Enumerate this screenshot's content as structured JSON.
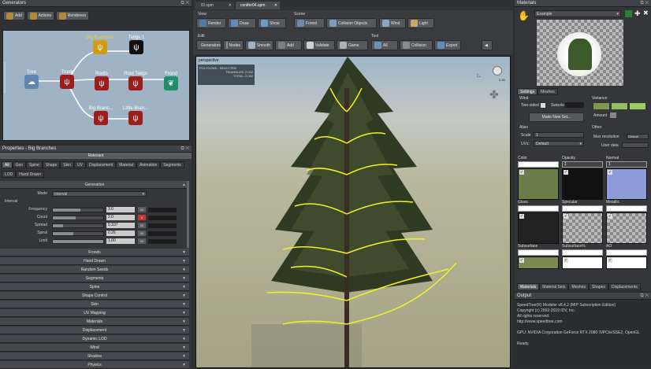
{
  "generator": {
    "title": "Generators",
    "add": "Add",
    "actions": "Actions",
    "renderers": "Renderers",
    "nodes": [
      {
        "id": "tree",
        "label": "Tree"
      },
      {
        "id": "trunk",
        "label": "Trunk"
      },
      {
        "id": "bigbranches",
        "label": "Big Branches"
      },
      {
        "id": "twigs1",
        "label": "Twigs 1"
      },
      {
        "id": "roots",
        "label": "Roots"
      },
      {
        "id": "roottwigs",
        "label": "Root Twigs"
      },
      {
        "id": "frond",
        "label": "Frond"
      },
      {
        "id": "bigbranches2",
        "label": "Big Branc..."
      },
      {
        "id": "littlebranches",
        "label": "Little Bran..."
      }
    ]
  },
  "tabs": {
    "t1": "ID.spm",
    "t2": "conifer04.spm"
  },
  "toolbar": {
    "view_label": "View",
    "scene_label": "Scene",
    "edit_label": "Edit",
    "tool_label": "Tool",
    "buttons": [
      "Render",
      "Draw",
      "Show",
      "Forest",
      "Collision Objects",
      "Wind",
      "Light",
      "Generators",
      "Nodes",
      "Smooth",
      "Add",
      "Validate",
      "Game",
      "All",
      "Collision",
      "Export"
    ]
  },
  "viewport": {
    "label": "perspective",
    "stats_title": "POLYGONS - SELECTED",
    "triangles_label": "TRIANGLES",
    "triangles": "2,032",
    "total_label": "TOTAL",
    "total": "2,032",
    "light_value": "0.45"
  },
  "properties": {
    "title": "Properties - Big Branches",
    "banner": "Relevant",
    "tabs": [
      "All",
      "Gen",
      "Spine",
      "Shape",
      "Skin",
      "UV",
      "Displacement",
      "Material",
      "Animation",
      "Segments",
      "LOD",
      "Hand Drawn"
    ],
    "generation": "Generation",
    "mode_label": "Mode",
    "mode_value": "Interval",
    "interval_label": "Interval",
    "rows": [
      {
        "label": "Frequency",
        "value": "3.0",
        "fill": 0.55,
        "pct": "50"
      },
      {
        "label": "Count",
        "value": "2.0",
        "fill": 0.45,
        "pct": "8"
      },
      {
        "label": "Spread",
        "value": "0.337",
        "fill": 0.2,
        "pct": "50"
      },
      {
        "label": "Spiral",
        "value": "0.26",
        "fill": 0.4,
        "pct": "50"
      },
      {
        "label": "Limit",
        "value": "1.00",
        "fill": 1.0,
        "pct": "50"
      }
    ],
    "sections": [
      "Fronds",
      "Hand Drawn",
      "Random Seeds",
      "Segments",
      "Spine",
      "Shape Control",
      "Skin",
      "UV Mapping",
      "Materials",
      "Displacement",
      "Dynamic LOD",
      "Wind",
      "Shadow",
      "Physics"
    ]
  },
  "materials": {
    "title": "Materials",
    "name_value": "Example",
    "tabs": [
      "Settings",
      "Meshes"
    ],
    "wind_label": "Wind",
    "twosided_label": "Two-sided",
    "swizzle_label": "Swizzle",
    "new_button": "Make New Set...",
    "alias_label": "Alias",
    "scale_label": "Scale",
    "scale_value": "1",
    "uv_label": "UVs:",
    "uv_value": "Default",
    "variance_label": "Variance",
    "amount_label": "Amount",
    "other_label": "Other",
    "maxres_label": "Max resolution",
    "maxres_value": "Default",
    "userdata_label": "User data",
    "slots": [
      "Color",
      "Opacity",
      "Normal",
      "Gloss",
      "Specular",
      "Metallic",
      "Subsurface",
      "Subsurface%",
      "AO"
    ],
    "opacity_value": "1",
    "normal_value": "1",
    "bottom_tabs": [
      "Materials",
      "Material Sets",
      "Meshes",
      "Shapes",
      "Displacements"
    ],
    "colors": {
      "green": "#7d9b4a",
      "lightgreen": "#93bd5e",
      "yellowgreen": "#9ccb5f"
    }
  },
  "output": {
    "title": "Output",
    "lines": [
      "SpeedTree(R) Modeler v8.4.2 (MIP Subscription Edition)",
      "Copyright (c) 2002-2019 IDV, Inc.",
      "All rights reserved.",
      "http://www.speedtree.com",
      "",
      "GPU: NVIDIA Corporation GeForce RTX 2080 Ti/PCIe/SSE2, OpenGL",
      "",
      "Ready."
    ]
  }
}
